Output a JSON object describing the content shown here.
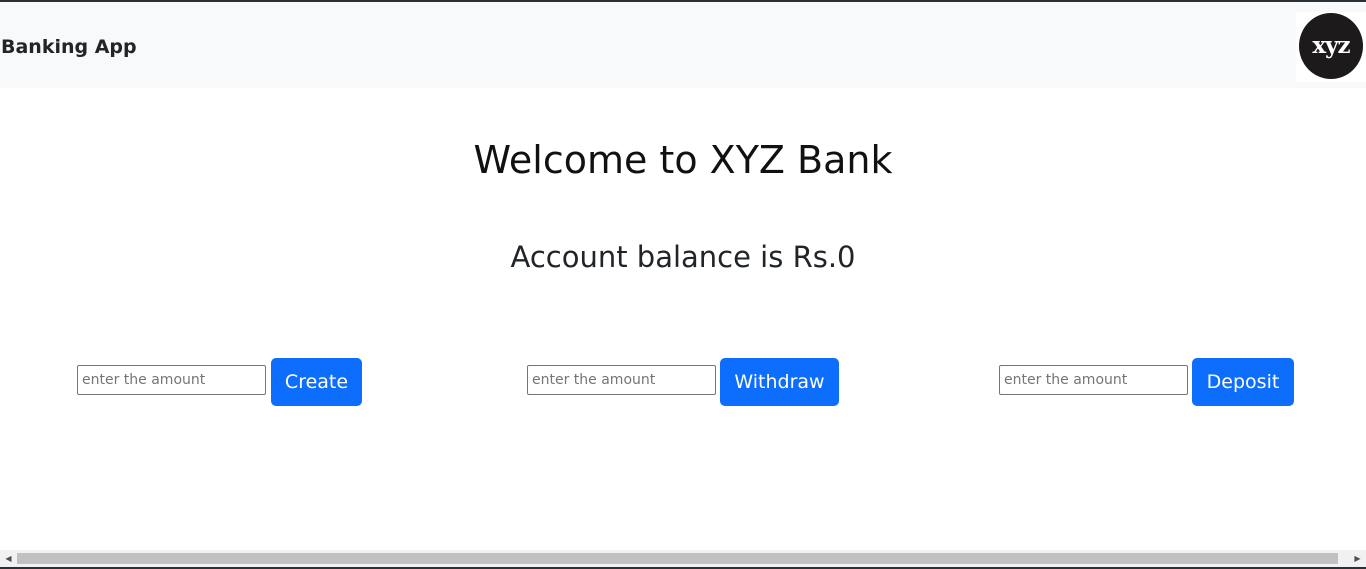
{
  "navbar": {
    "brand": "Banking App",
    "logo_text": "xyz"
  },
  "main": {
    "title": "Welcome to XYZ Bank",
    "balance_text": "Account balance is Rs.0"
  },
  "forms": {
    "create": {
      "placeholder": "enter the amount",
      "button_label": "Create"
    },
    "withdraw": {
      "placeholder": "enter the amount",
      "button_label": "Withdraw"
    },
    "deposit": {
      "placeholder": "enter the amount",
      "button_label": "Deposit"
    }
  },
  "colors": {
    "primary_button": "#0d6efd",
    "navbar_bg": "#f8f9fa",
    "logo_bg": "#1c1a1a"
  },
  "icons": {
    "scroll_left": "arrow-left-icon",
    "scroll_right": "arrow-right-icon"
  }
}
